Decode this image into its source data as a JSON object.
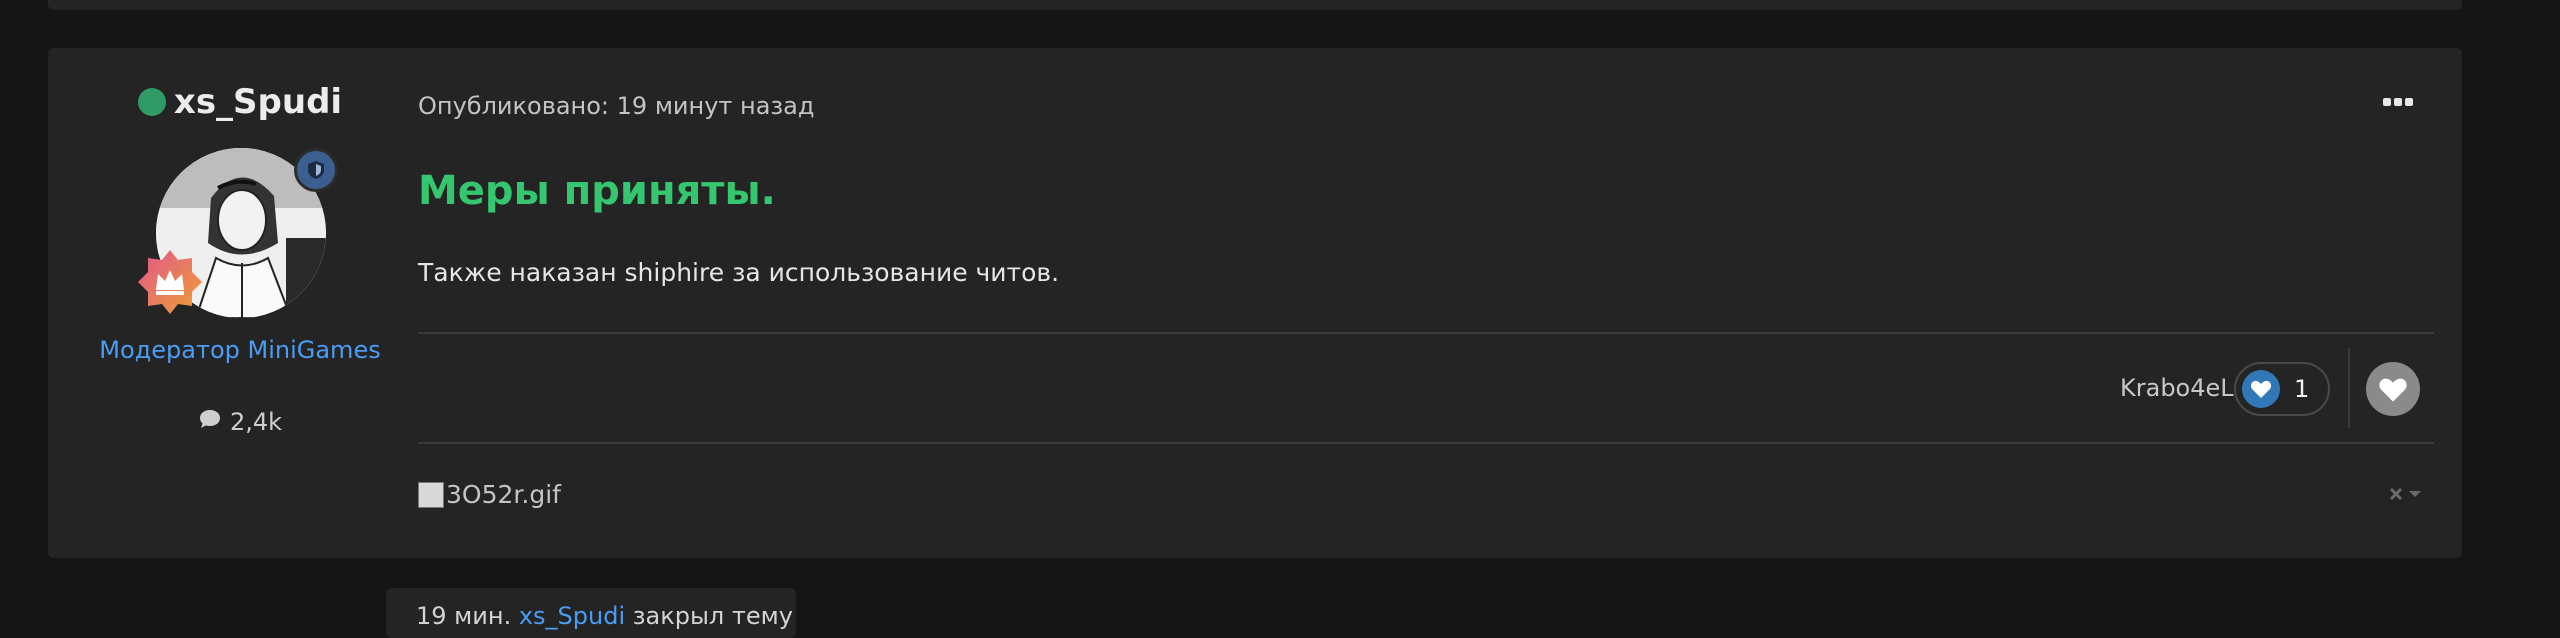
{
  "post": {
    "author": {
      "name": "xs_Spudi",
      "online": true,
      "role": "Модератор MiniGames",
      "post_count": "2,4k"
    },
    "meta": {
      "published": "Опубликовано: 19 минут назад"
    },
    "content": {
      "headline": "Меры приняты.",
      "body": "Также наказан shiphire за использование читов."
    },
    "reactions": {
      "user": "Krabo4eL",
      "count": "1",
      "reaction_icon": "heart-icon"
    },
    "signature": {
      "image_alt": "3O52r.gif"
    }
  },
  "event": {
    "time": "19 мин.",
    "user": "xs_Spudi",
    "action": "закрыл тему"
  },
  "colors": {
    "accent_green": "#35c76f",
    "link_blue": "#4a9df5",
    "online": "#2f9c68",
    "background": "#151515",
    "card": "#242424"
  }
}
